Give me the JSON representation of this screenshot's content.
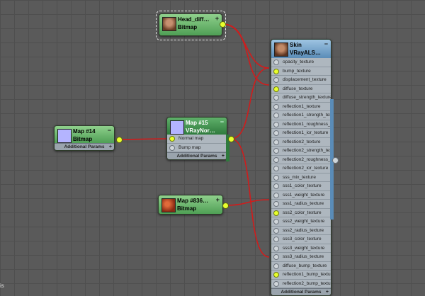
{
  "nodes": {
    "head_diffuse": {
      "name": "Head_diff…",
      "type": "Bitmap",
      "control": "+"
    },
    "skin": {
      "name": "Skin",
      "type": "VRayALS…",
      "control": "−",
      "slots": [
        "opacity_texture",
        "bump_texture",
        "displacement_texture",
        "diffuse_texture",
        "diffuse_strength_texture",
        "reflection1_texture",
        "reflection1_strength_text…",
        "reflection1_roughness_te…",
        "reflection1_ior_texture",
        "reflection2_texture",
        "reflection2_strength_text…",
        "reflection2_roughness_te…",
        "reflection2_ior_texture",
        "sss_mix_texture",
        "sss1_color_texture",
        "sss1_weight_texture",
        "sss1_radius_texture",
        "sss2_color_texture",
        "sss2_weight_texture",
        "sss2_radius_texture",
        "sss3_color_texture",
        "sss3_weight_texture",
        "sss3_radius_texture",
        "diffuse_bump_texture",
        "reflection1_bump_texture",
        "reflection2_bump_texture"
      ],
      "connected_slots": [
        "bump_texture",
        "diffuse_texture",
        "sss2_color_texture",
        "reflection1_bump_texture"
      ],
      "footer": "Additional Params",
      "footer_control": "+"
    },
    "map14": {
      "name": "Map #14",
      "type": "Bitmap",
      "control": "−",
      "footer": "Additional Params",
      "footer_control": "+"
    },
    "map15": {
      "name": "Map #15",
      "type": "VRayNor…",
      "control": "−",
      "slots": [
        "Normal map",
        "Bump map"
      ],
      "connected_slots": [
        "Normal map"
      ],
      "footer": "Additional Params",
      "footer_control": "+"
    },
    "map836": {
      "name": "Map #836…",
      "type": "Bitmap",
      "control": "+"
    }
  },
  "corner_label": "is",
  "colors": {
    "wire": "#d01c1c",
    "socket": "#e8ff2e",
    "canvas": "#5a5a5a"
  }
}
